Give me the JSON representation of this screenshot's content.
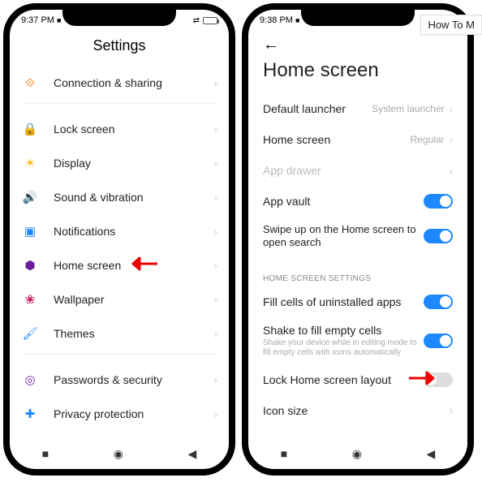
{
  "tooltip": "How To M",
  "phone1": {
    "time": "9:37 PM",
    "cam": "■",
    "title": "Settings",
    "items": [
      {
        "icon": "⟐",
        "color": "#ff6b00",
        "label": "Connection & sharing"
      },
      {
        "divider": true
      },
      {
        "icon": "🔒",
        "color": "#e53935",
        "label": "Lock screen"
      },
      {
        "icon": "☀",
        "color": "#ffb300",
        "label": "Display"
      },
      {
        "icon": "🔊",
        "color": "#2e7d32",
        "label": "Sound & vibration"
      },
      {
        "icon": "▣",
        "color": "#1e88ff",
        "label": "Notifications"
      },
      {
        "icon": "⬢",
        "color": "#6a1b9a",
        "label": "Home screen",
        "arrow": true
      },
      {
        "icon": "❀",
        "color": "#c2185b",
        "label": "Wallpaper"
      },
      {
        "icon": "🖌",
        "color": "#1e88ff",
        "label": "Themes"
      },
      {
        "divider": true
      },
      {
        "icon": "◎",
        "color": "#7b1fa2",
        "label": "Passwords & security"
      },
      {
        "icon": "✚",
        "color": "#1e88ff",
        "label": "Privacy protection"
      }
    ]
  },
  "phone2": {
    "time": "9:38 PM",
    "cam": "■",
    "title": "Home screen",
    "rows": [
      {
        "label": "Default launcher",
        "value": "System launcher",
        "chev": true
      },
      {
        "label": "Home screen",
        "value": "Regular",
        "chev": true
      },
      {
        "label": "App drawer",
        "dim": true,
        "chev": true
      },
      {
        "label": "App vault",
        "toggle": "on"
      },
      {
        "label": "Swipe up on the Home screen to open search",
        "toggle": "on",
        "wrap": true
      }
    ],
    "section_header": "HOME SCREEN SETTINGS",
    "rows2": [
      {
        "label": "Fill cells of uninstalled apps",
        "toggle": "on"
      },
      {
        "label": "Shake to fill empty cells",
        "desc": "Shake your device while in editing mode to fill empty cells with icons automatically",
        "toggle": "on"
      },
      {
        "label": "Lock Home screen layout",
        "toggle": "off",
        "arrow": true
      },
      {
        "label": "Icon size",
        "chev": true
      }
    ]
  },
  "nav": {
    "recent": "■",
    "home": "◉",
    "back": "◀"
  }
}
